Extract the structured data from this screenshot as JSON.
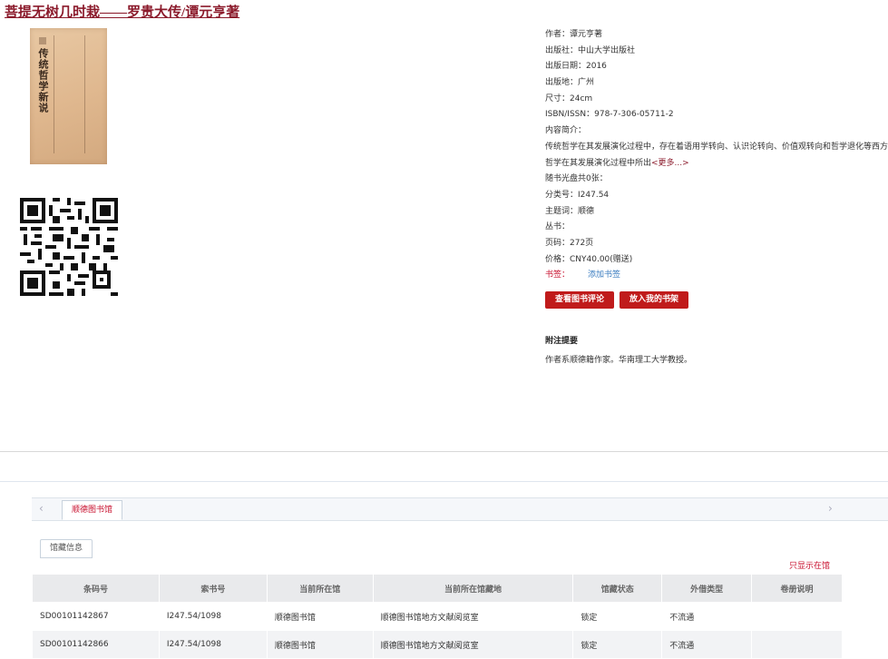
{
  "title": {
    "book": "菩提无树几时栽——罗贵大传",
    "separator": "/",
    "author": "谭元亨著"
  },
  "cover": {
    "title_text": "传统哲学新说"
  },
  "details": {
    "author": "作者：谭元亨著",
    "publisher": "出版社：中山大学出版社",
    "pub_date": "出版日期：2016",
    "pub_place": "出版地：广州",
    "size": "尺寸：24cm",
    "isbn": "ISBN/ISSN：978-7-306-05711-2",
    "summary_label": "内容简介：",
    "summary_text": "传统哲学在其发展演化过程中，存在着语用学转向、认识论转向、价值观转向和哲学退化等西方哲学在其发展演化过程中所出",
    "more_link": "<更多...>",
    "cd_info": "随书光盘共0张：",
    "class_no": "分类号：I247.54",
    "subject": "主题词：顺德",
    "series": "丛书：",
    "pages": "页码：272页",
    "price": "价格：CNY40.00(赠送)",
    "tags_label": "书签：",
    "add_tag": "添加书签"
  },
  "buttons": {
    "view_reviews": "查看图书评论",
    "add_shelf": "放入我的书架"
  },
  "notes": {
    "heading": "附注提要",
    "text": "作者系顺德籍作家。华南理工大学教授。"
  },
  "holdings": {
    "library_tab": "顺德图书馆",
    "info_tab": "馆藏信息",
    "only_show": "只显示在馆",
    "columns": [
      "条码号",
      "索书号",
      "当前所在馆",
      "当前所在馆藏地",
      "馆藏状态",
      "外借类型",
      "卷册说明"
    ],
    "rows": [
      [
        "SD00101142867",
        "I247.54/1098",
        "顺德图书馆",
        "顺德图书馆地方文献阅览室",
        "锁定",
        "不流通",
        ""
      ],
      [
        "SD00101142866",
        "I247.54/1098",
        "顺德图书馆",
        "顺德图书馆地方文献阅览室",
        "锁定",
        "不流通",
        ""
      ]
    ]
  },
  "icons": {
    "prev": "chevron-left-icon",
    "next": "chevron-right-icon"
  }
}
